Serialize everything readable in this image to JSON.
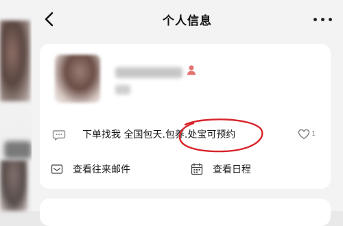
{
  "header": {
    "title": "个人信息",
    "back_icon": "back-chevron-icon",
    "more_icon": "more-dots-icon"
  },
  "profile": {
    "gender_icon": "female-user-icon",
    "bio": "下单找我 全国包天.包养.处宝可预约",
    "bio_icon": "chat-bubble-icon",
    "like_icon": "heart-icon",
    "like_count": "1"
  },
  "actions": {
    "mail_label": "查看往来邮件",
    "mail_icon": "mail-icon",
    "schedule_label": "查看日程",
    "schedule_icon": "calendar-icon"
  },
  "colors": {
    "accent_red": "#d8232a",
    "gender_icon": "#e57373"
  }
}
